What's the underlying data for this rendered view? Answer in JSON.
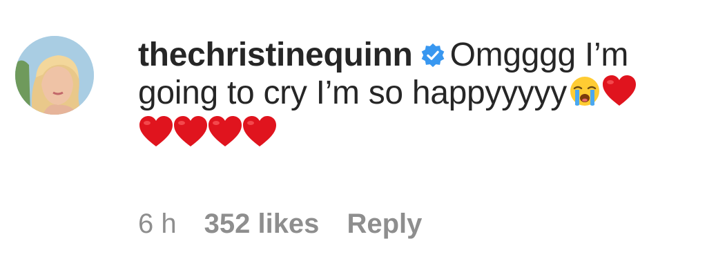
{
  "comment": {
    "username": "thechristinequinn",
    "verified": true,
    "text_line_1": "Omgggg I’m",
    "text_line_2": "going to cry I’m so happyyyyy",
    "emojis_inline": [
      "loudly-crying-face",
      "red-heart"
    ],
    "hearts_row_count": 4,
    "hearts_row": [
      "red-heart",
      "red-heart",
      "red-heart",
      "red-heart"
    ],
    "timestamp": "6 h",
    "likes": "352 likes",
    "reply_label": "Reply"
  },
  "colors": {
    "text": "#262626",
    "meta": "#8e8e8e",
    "verified_blue": "#3897f0",
    "heart_red": "#e0141e"
  }
}
